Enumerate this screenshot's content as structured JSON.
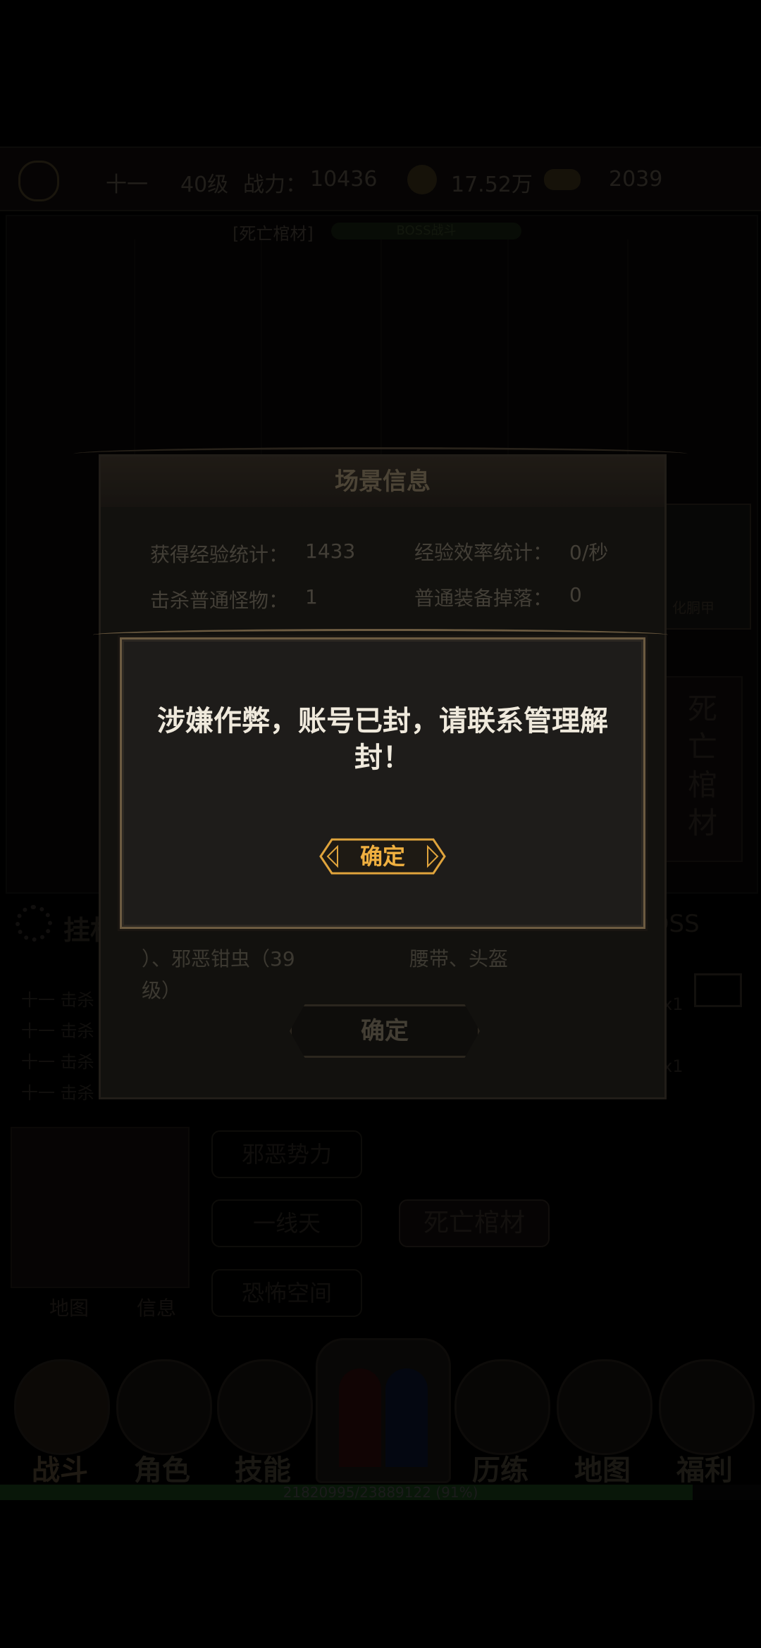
{
  "topbar": {
    "player_name": "十一",
    "level": "40级",
    "power_label": "战力：",
    "power_value": "10436",
    "coins": "17.52万",
    "ingots": "2039"
  },
  "boss_bar": {
    "target": "[死亡棺材]",
    "label": "BOSS战斗"
  },
  "scene_dialog": {
    "title": "场景信息",
    "exp_label": "获得经验统计：",
    "exp_value": "1433",
    "rate_label": "经验效率统计：",
    "rate_value": "0/秒",
    "kill_label": "击杀普通怪物：",
    "kill_value": "1",
    "drop_label": "普通装备掉落：",
    "drop_value": "0",
    "monsters_text_1": "）、邪恶钳虫（39",
    "monsters_text_2": "级）",
    "drops_text": "腰带、头盔",
    "ok_label": "确定"
  },
  "alert": {
    "message": "涉嫌作弊，账号已封，请联系管理解封！",
    "ok_label": "确定"
  },
  "side_panel": {
    "boss_name_vertical": "死亡棺材",
    "card_label": "化胴甲"
  },
  "hangup_label": "挂机",
  "boss_button": "BOSS",
  "log_lines": [
    "十一 击杀",
    "十一 击杀",
    "十一 击杀",
    "十一 击杀"
  ],
  "log_extra": [
    "x1",
    "x1"
  ],
  "map": {
    "map_button": "地图",
    "info_button": "信息",
    "nodes": [
      "邪恶势力",
      "一线天",
      "恐怖空间",
      "死亡棺材"
    ]
  },
  "nav": {
    "tabs": [
      "战斗",
      "角色",
      "技能",
      "历练",
      "地图",
      "福利"
    ]
  },
  "exp_bar": {
    "text": "21820995/23889122 (91%)",
    "fraction": 0.91
  },
  "colors": {
    "accent": "#e0a43c",
    "background": "#000000",
    "dialog": "#1e1c1a"
  }
}
